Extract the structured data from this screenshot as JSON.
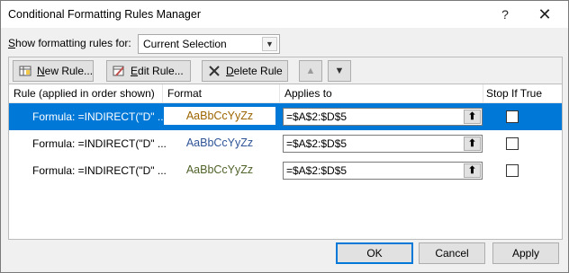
{
  "window": {
    "title": "Conditional Formatting Rules Manager",
    "help_glyph": "?",
    "close_glyph": "✕"
  },
  "show_rules": {
    "label_prefix": "",
    "label_accel": "S",
    "label_rest": "how formatting rules for:",
    "selected": "Current Selection"
  },
  "toolbar": {
    "new_accel": "N",
    "new_rest": "ew Rule...",
    "edit_accel": "E",
    "edit_rest": "dit Rule...",
    "delete_accel": "D",
    "delete_rest": "elete Rule",
    "move_up_glyph": "▲",
    "move_down_glyph": "▼"
  },
  "columns": {
    "rule": "Rule (applied in order shown)",
    "format": "Format",
    "applies_to": "Applies to",
    "stop_if_true": "Stop If True"
  },
  "rules": [
    {
      "rule": "Formula: =INDIRECT(\"D\" ...",
      "preview": "AaBbCcYyZz",
      "preview_color": "#9c6500",
      "applies_to": "=$A$2:$D$5",
      "stop_if_true": false,
      "selected": true
    },
    {
      "rule": "Formula: =INDIRECT(\"D\" ...",
      "preview": "AaBbCcYyZz",
      "preview_color": "#2f5597",
      "applies_to": "=$A$2:$D$5",
      "stop_if_true": false,
      "selected": false
    },
    {
      "rule": "Formula: =INDIRECT(\"D\" ...",
      "preview": "AaBbCcYyZz",
      "preview_color": "#4f6228",
      "applies_to": "=$A$2:$D$5",
      "stop_if_true": false,
      "selected": false
    }
  ],
  "picker_glyph": "⬆",
  "buttons": {
    "ok": "OK",
    "cancel": "Cancel",
    "apply": "Apply"
  }
}
